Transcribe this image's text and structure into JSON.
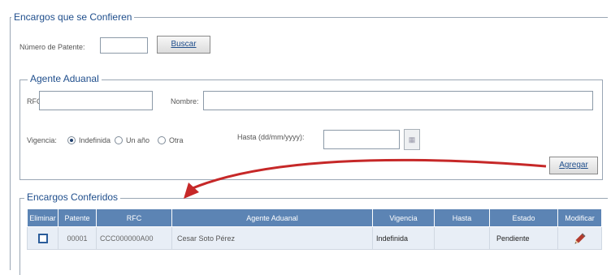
{
  "encargos": {
    "title": "Encargos que se Confieren",
    "patente_label": "Número de Patente:",
    "patente_value": "",
    "buscar_label": "Buscar"
  },
  "agente": {
    "title": "Agente Aduanal",
    "rfc_label": "RFC:",
    "rfc_value": "",
    "nombre_label": "Nombre:",
    "nombre_value": ""
  },
  "vigencia": {
    "label": "Vigencia:",
    "options": [
      "Indefinida",
      "Un año",
      "Otra"
    ],
    "selected": "Indefinida",
    "hasta_label": "Hasta (dd/mm/yyyy):",
    "hasta_value": "",
    "agregar_label": "Agregar"
  },
  "conferidos": {
    "title": "Encargos Conferidos",
    "columns": [
      "Eliminar",
      "Patente",
      "RFC",
      "Agente Aduanal",
      "Vigencia",
      "Hasta",
      "Estado",
      "Modificar"
    ],
    "rows": [
      {
        "patente": "00001",
        "rfc": "CCC000000A00",
        "agente": "Cesar Soto Pérez",
        "vigencia": "Indefinida",
        "hasta": "",
        "estado": "Pendiente"
      }
    ]
  },
  "icons": {
    "edit": "pencil-icon",
    "calendar": "calendar-icon",
    "checkbox": "checkbox-icon"
  },
  "colors": {
    "accent": "#1f4e8c",
    "header": "#5c84b4",
    "arrow": "#c62828"
  }
}
